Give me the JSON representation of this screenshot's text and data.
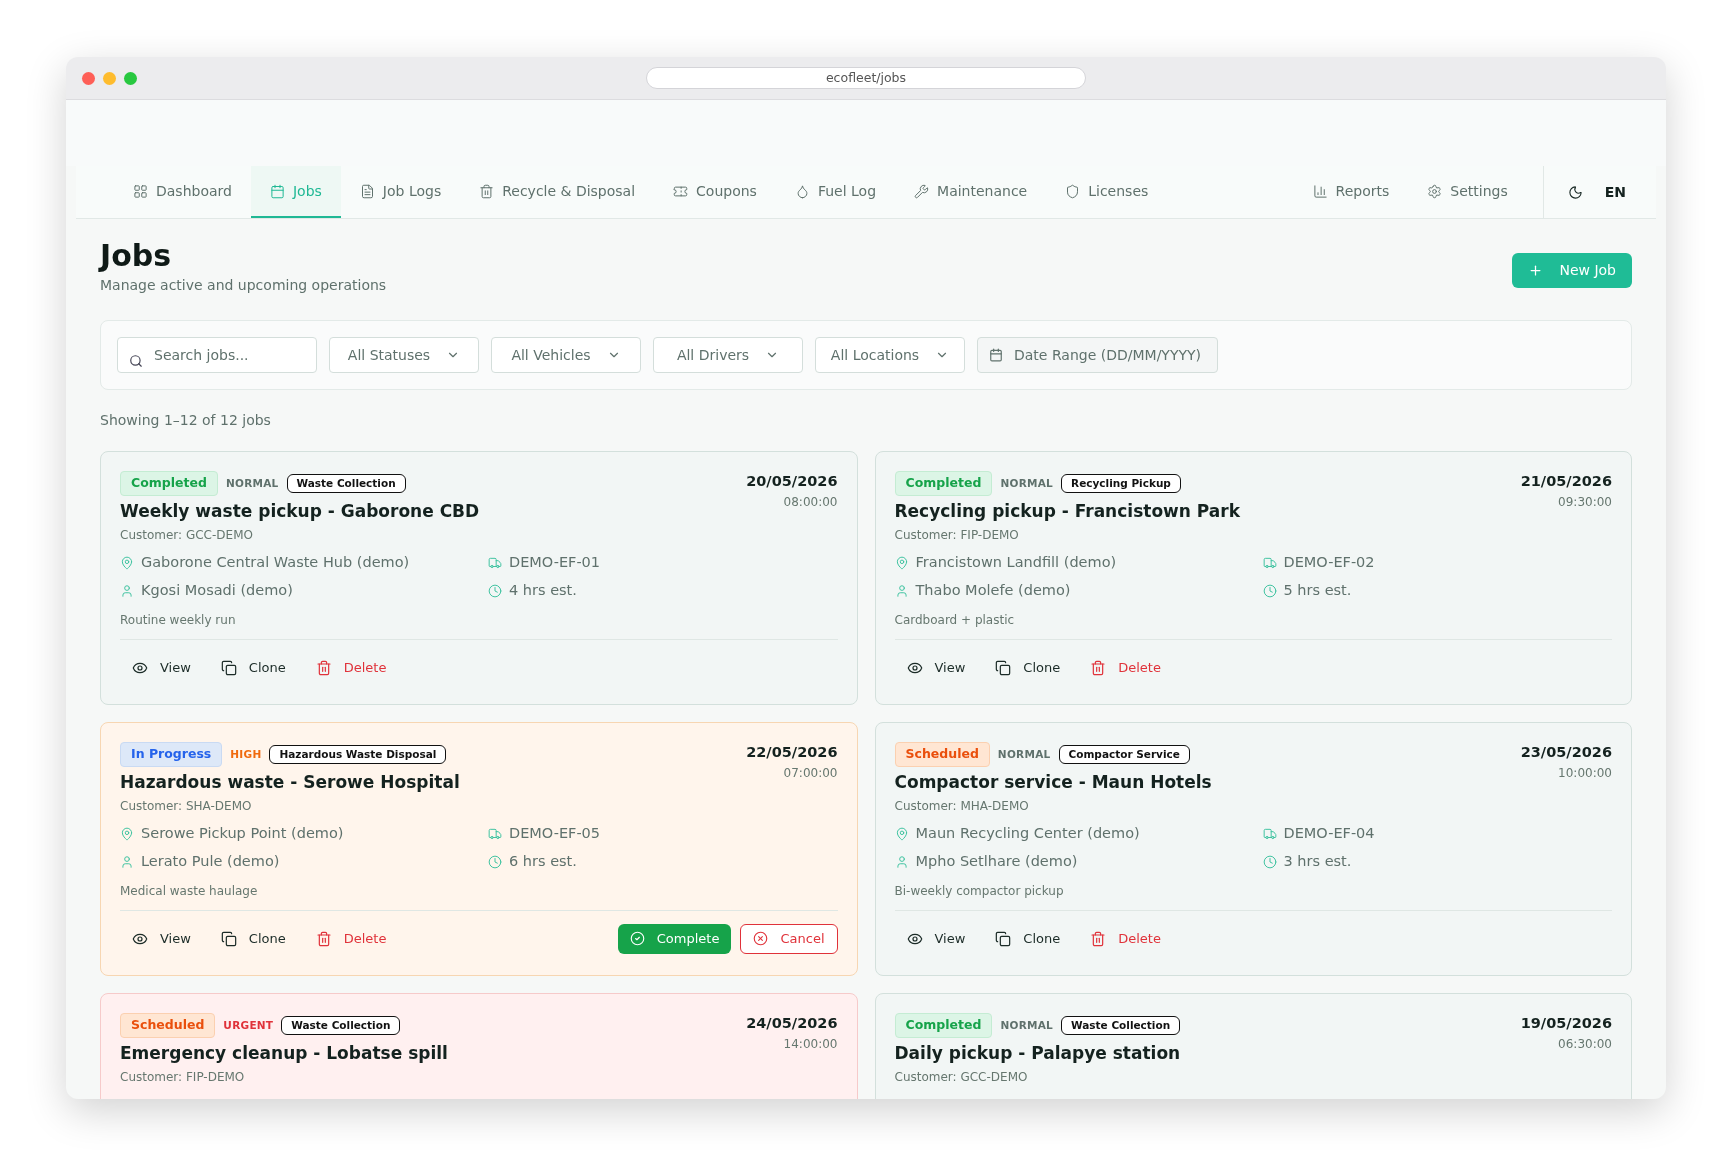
{
  "browser": {
    "address": "ecofleet/jobs"
  },
  "nav": {
    "items": [
      {
        "label": "Dashboard",
        "selected": false
      },
      {
        "label": "Jobs",
        "selected": true
      },
      {
        "label": "Job Logs",
        "selected": false
      },
      {
        "label": "Recycle & Disposal",
        "selected": false
      },
      {
        "label": "Coupons",
        "selected": false
      },
      {
        "label": "Fuel Log",
        "selected": false
      },
      {
        "label": "Maintenance",
        "selected": false
      },
      {
        "label": "Licenses",
        "selected": false
      }
    ],
    "right_items": [
      {
        "label": "Reports",
        "selected": false
      },
      {
        "label": "Settings",
        "selected": false
      }
    ],
    "language": {
      "label": "EN",
      "selected": true
    }
  },
  "page": {
    "title": "Jobs",
    "subtitle": "Manage active and upcoming operations",
    "new_button": "New Job"
  },
  "filters": {
    "search": {
      "placeholder": "Search jobs..."
    },
    "selects": [
      "All Statuses",
      "All Vehicles",
      "All Drivers",
      "All Locations"
    ],
    "date_range": {
      "placeholder": "Date Range (DD/MM/YYYY)"
    }
  },
  "summary": "Showing 1–12 of 12 jobs",
  "jobs": [
    {
      "status": {
        "label": "Completed",
        "kind": "completed"
      },
      "priority": {
        "label": "NORMAL",
        "kind": "normal"
      },
      "type": "Waste Collection",
      "date": "20/05/2026",
      "time": "08:00:00",
      "title": "Weekly waste pickup - Gaborone CBD",
      "customer": "Customer: GCC-DEMO",
      "location": "Gaborone Central Waste Hub (demo)",
      "vehicle": "DEMO-EF-01",
      "driver": "Kgosi Mosadi (demo)",
      "duration": "4 hrs est.",
      "note": "Routine weekly run",
      "actions": [
        "View",
        "Clone",
        "Delete"
      ]
    },
    {
      "status": {
        "label": "Completed",
        "kind": "completed"
      },
      "priority": {
        "label": "NORMAL",
        "kind": "normal"
      },
      "type": "Recycling Pickup",
      "date": "21/05/2026",
      "time": "09:30:00",
      "title": "Recycling pickup - Francistown Park",
      "customer": "Customer: FIP-DEMO",
      "location": "Francistown Landfill (demo)",
      "vehicle": "DEMO-EF-02",
      "driver": "Thabo Molefe (demo)",
      "duration": "5 hrs est.",
      "note": "Cardboard + plastic",
      "actions": [
        "View",
        "Clone",
        "Delete"
      ]
    },
    {
      "status": {
        "label": "In Progress",
        "kind": "in_progress"
      },
      "priority": {
        "label": "HIGH",
        "kind": "high"
      },
      "type": "Hazardous Waste Disposal",
      "date": "22/05/2026",
      "time": "07:00:00",
      "title": "Hazardous waste - Serowe Hospital",
      "customer": "Customer: SHA-DEMO",
      "location": "Serowe Pickup Point (demo)",
      "vehicle": "DEMO-EF-05",
      "driver": "Lerato Pule (demo)",
      "duration": "6 hrs est.",
      "note": "Medical waste haulage",
      "actions": [
        "View",
        "Clone",
        "Delete"
      ],
      "complete_button": "Complete",
      "cancel_button": "Cancel"
    },
    {
      "status": {
        "label": "Scheduled",
        "kind": "scheduled"
      },
      "priority": {
        "label": "NORMAL",
        "kind": "normal"
      },
      "type": "Compactor Service",
      "date": "23/05/2026",
      "time": "10:00:00",
      "title": "Compactor service - Maun Hotels",
      "customer": "Customer: MHA-DEMO",
      "location": "Maun Recycling Center (demo)",
      "vehicle": "DEMO-EF-04",
      "driver": "Mpho Setlhare (demo)",
      "duration": "3 hrs est.",
      "note": "Bi-weekly compactor pickup",
      "actions": [
        "View",
        "Clone",
        "Delete"
      ]
    },
    {
      "status": {
        "label": "Scheduled",
        "kind": "scheduled"
      },
      "priority": {
        "label": "URGENT",
        "kind": "urgent"
      },
      "type": "Waste Collection",
      "date": "24/05/2026",
      "time": "14:00:00",
      "title": "Emergency cleanup - Lobatse spill",
      "customer": "Customer: FIP-DEMO"
    },
    {
      "status": {
        "label": "Completed",
        "kind": "completed"
      },
      "priority": {
        "label": "NORMAL",
        "kind": "normal"
      },
      "type": "Waste Collection",
      "date": "19/05/2026",
      "time": "06:30:00",
      "title": "Daily pickup - Palapye station",
      "customer": "Customer: GCC-DEMO"
    }
  ]
}
